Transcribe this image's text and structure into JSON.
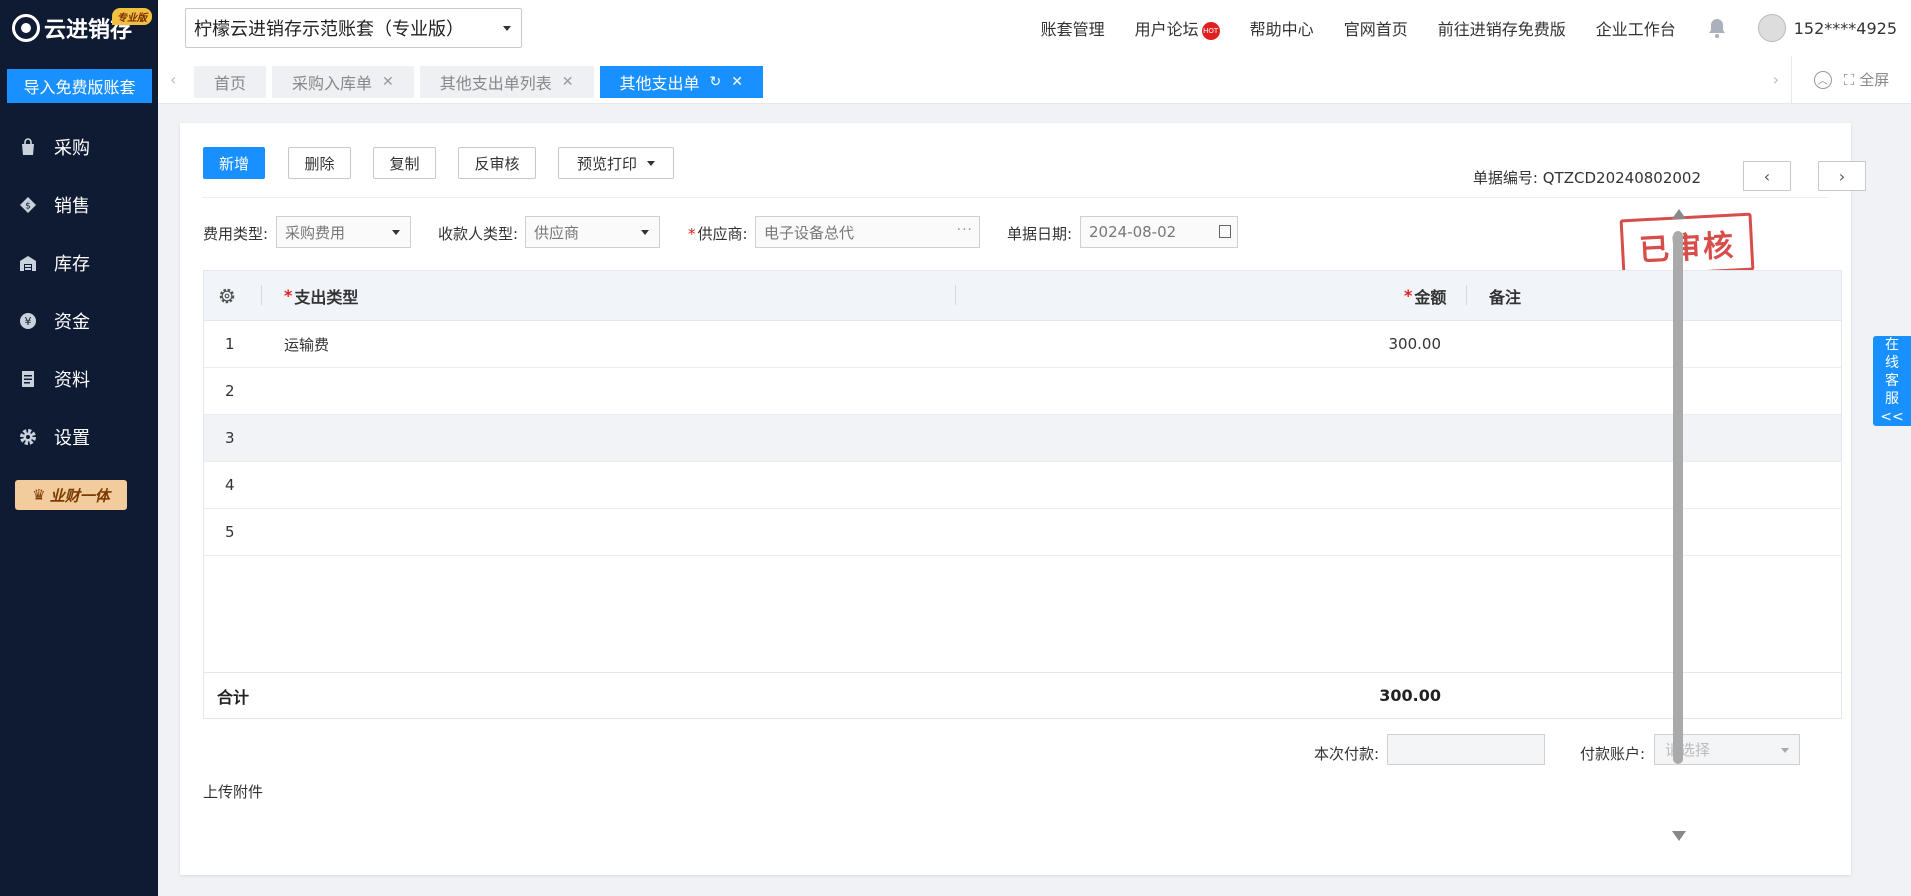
{
  "brand": {
    "name": "云进销存",
    "badge": "专业版"
  },
  "sidebar": {
    "import_label": "导入免费版账套",
    "items": [
      {
        "label": "采购",
        "icon": "bag-icon"
      },
      {
        "label": "销售",
        "icon": "money-tag-icon"
      },
      {
        "label": "库存",
        "icon": "warehouse-icon"
      },
      {
        "label": "资金",
        "icon": "yuan-icon"
      },
      {
        "label": "资料",
        "icon": "document-icon"
      },
      {
        "label": "设置",
        "icon": "gear-icon"
      }
    ],
    "promo_label": "业财一体"
  },
  "header": {
    "account": "柠檬云进销存示范账套（专业版）",
    "links": [
      "账套管理",
      "用户论坛",
      "帮助中心",
      "官网首页",
      "前往进销存免费版",
      "企业工作台"
    ],
    "hot_badge": "HOT",
    "user_phone": "152****4925"
  },
  "tabs": {
    "items": [
      {
        "label": "首页",
        "closable": false
      },
      {
        "label": "采购入库单",
        "closable": true
      },
      {
        "label": "其他支出单列表",
        "closable": true
      },
      {
        "label": "其他支出单",
        "closable": true,
        "active": true
      }
    ],
    "fullscreen_label": "全屏"
  },
  "toolbar": {
    "new_label": "新增",
    "delete_label": "删除",
    "copy_label": "复制",
    "unaudit_label": "反审核",
    "print_label": "预览打印"
  },
  "doc": {
    "number_label": "单据编号:",
    "number": "QTZCD20240802002",
    "stamp": "已审核"
  },
  "form": {
    "expense_type_label": "费用类型:",
    "expense_type": "采购费用",
    "payee_type_label": "收款人类型:",
    "payee_type": "供应商",
    "supplier_label": "供应商:",
    "supplier": "电子设备总代",
    "date_label": "单据日期:",
    "date": "2024-08-02"
  },
  "grid": {
    "columns": [
      "支出类型",
      "金额",
      "备注"
    ],
    "rows": [
      {
        "no": "1",
        "type": "运输费",
        "amount": "300.00",
        "note": ""
      },
      {
        "no": "2",
        "type": "",
        "amount": "",
        "note": ""
      },
      {
        "no": "3",
        "type": "",
        "amount": "",
        "note": ""
      },
      {
        "no": "4",
        "type": "",
        "amount": "",
        "note": ""
      },
      {
        "no": "5",
        "type": "",
        "amount": "",
        "note": ""
      }
    ],
    "total_label": "合计",
    "total_amount": "300.00"
  },
  "payment": {
    "amount_label": "本次付款:",
    "amount_value": "",
    "account_label": "付款账户:",
    "account_placeholder": "请选择"
  },
  "upload_label": "上传附件",
  "online_service": [
    "在",
    "线",
    "客",
    "服",
    "<<"
  ],
  "colors": {
    "accent": "#1890ff",
    "sidebar_bg": "#0f1b33",
    "stamp": "#d33a36"
  }
}
